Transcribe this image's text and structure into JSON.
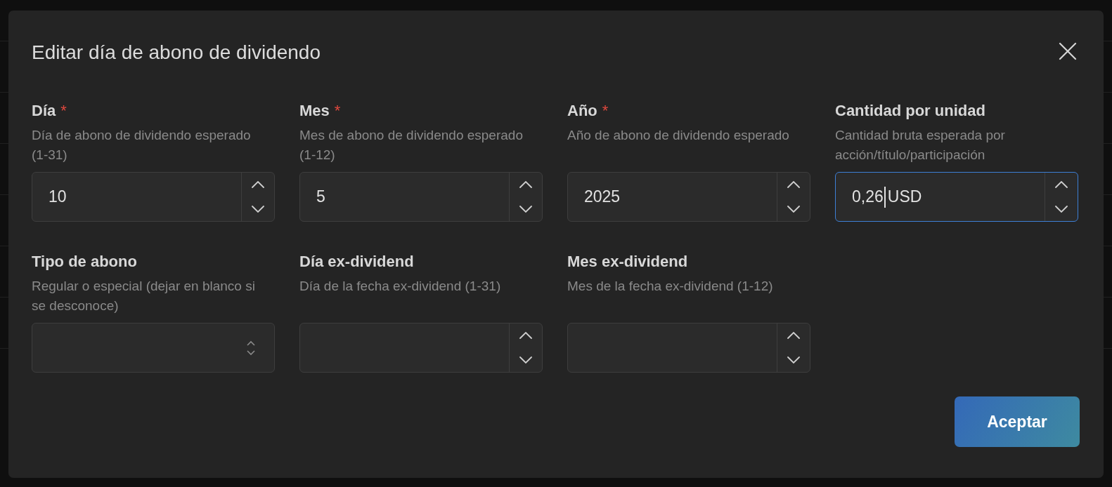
{
  "dialog": {
    "title": "Editar día de abono de dividendo",
    "fields": [
      {
        "kind": "number",
        "label": "Día",
        "required_mark": "*",
        "help": "Día de abono de dividendo esperado (1-31)",
        "value": "10",
        "focused": false
      },
      {
        "kind": "number",
        "label": "Mes",
        "required_mark": "*",
        "help": "Mes de abono de dividendo esperado (1-12)",
        "value": "5",
        "focused": false
      },
      {
        "kind": "number",
        "label": "Año",
        "required_mark": "*",
        "help": "Año de abono de dividendo esperado",
        "value": "2025",
        "focused": false
      },
      {
        "kind": "number",
        "label": "Cantidad por unidad",
        "help": "Cantidad bruta esperada por acción/título/participación",
        "value": "0,26",
        "suffix": "USD",
        "focused": true
      },
      {
        "kind": "select",
        "label": "Tipo de abono",
        "help": "Regular o especial (dejar en blanco si se desconoce)",
        "focused": false
      },
      {
        "kind": "number",
        "label": "Día ex-dividend",
        "help": "Día de la fecha ex-dividend (1-31)",
        "focused": false
      },
      {
        "kind": "number",
        "label": "Mes ex-dividend",
        "help": "Mes de la fecha ex-dividend (1-12)",
        "focused": false
      }
    ],
    "buttons": [
      {
        "label": "Aceptar"
      }
    ]
  }
}
